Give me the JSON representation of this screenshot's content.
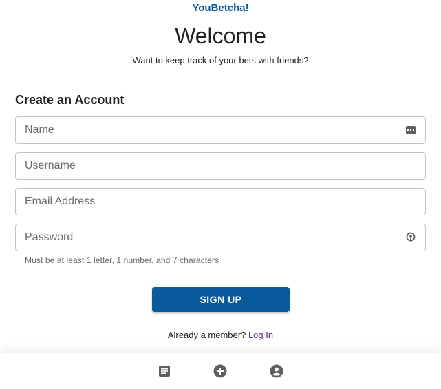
{
  "app": {
    "brand": "YouBetcha!"
  },
  "header": {
    "title": "Welcome",
    "tagline": "Want to keep track of your bets with friends?"
  },
  "form": {
    "title": "Create an Account",
    "name": {
      "placeholder": "Name",
      "value": "",
      "icon": "contact-card-icon"
    },
    "username": {
      "placeholder": "Username",
      "value": ""
    },
    "email": {
      "placeholder": "Email Address",
      "value": ""
    },
    "password": {
      "placeholder": "Password",
      "value": "",
      "icon": "password-key-icon"
    },
    "password_helper": "Must be at least 1 letter, 1 number, and 7 characters",
    "submit_label": "SIGN UP"
  },
  "footer": {
    "member_prompt": "Already a member?",
    "login_label": "Log In"
  },
  "bottom_nav": {
    "items": [
      {
        "icon": "document-icon"
      },
      {
        "icon": "add-circle-icon"
      },
      {
        "icon": "account-icon"
      }
    ]
  },
  "colors": {
    "brand": "#0a5a99",
    "button": "#0a5a9e",
    "link": "#5b2a86",
    "icon": "#5f5f5f"
  }
}
